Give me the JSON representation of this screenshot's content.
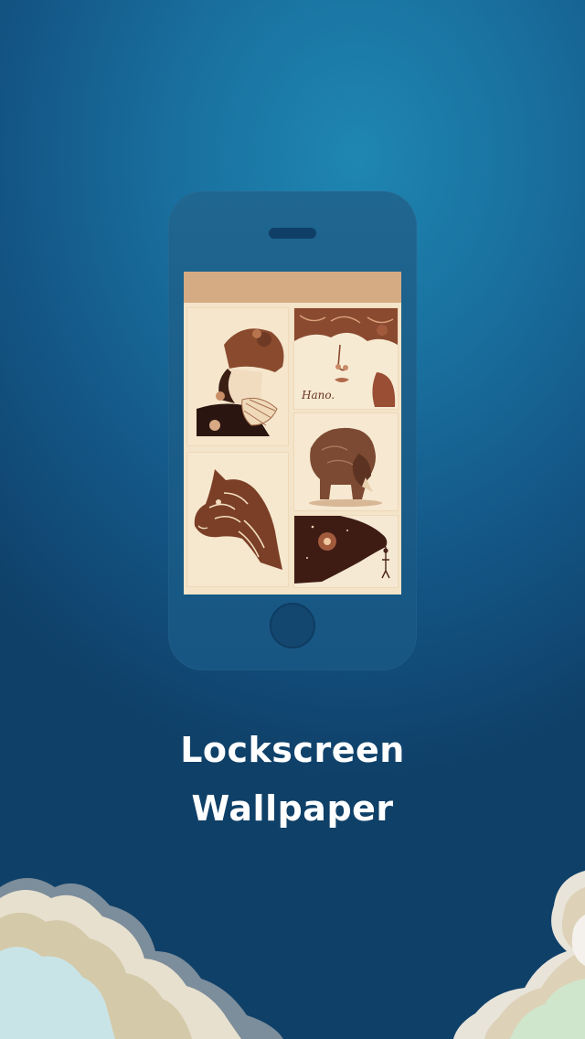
{
  "caption": {
    "line1": "Lockscreen",
    "line2": "Wallpaper"
  },
  "thumbnail_text": {
    "hano": "Hano."
  },
  "colors": {
    "background": "#1b78a6",
    "phone_body": "#1c5f8b",
    "screen_header": "#d5ab84",
    "screen_background": "#f4e4c9",
    "sepia_dark": "#5a2f1e",
    "sepia_mid": "#a56e4e"
  },
  "icons": {
    "phone": "smartphone-outline",
    "home_button": "circle",
    "speaker": "pill"
  }
}
